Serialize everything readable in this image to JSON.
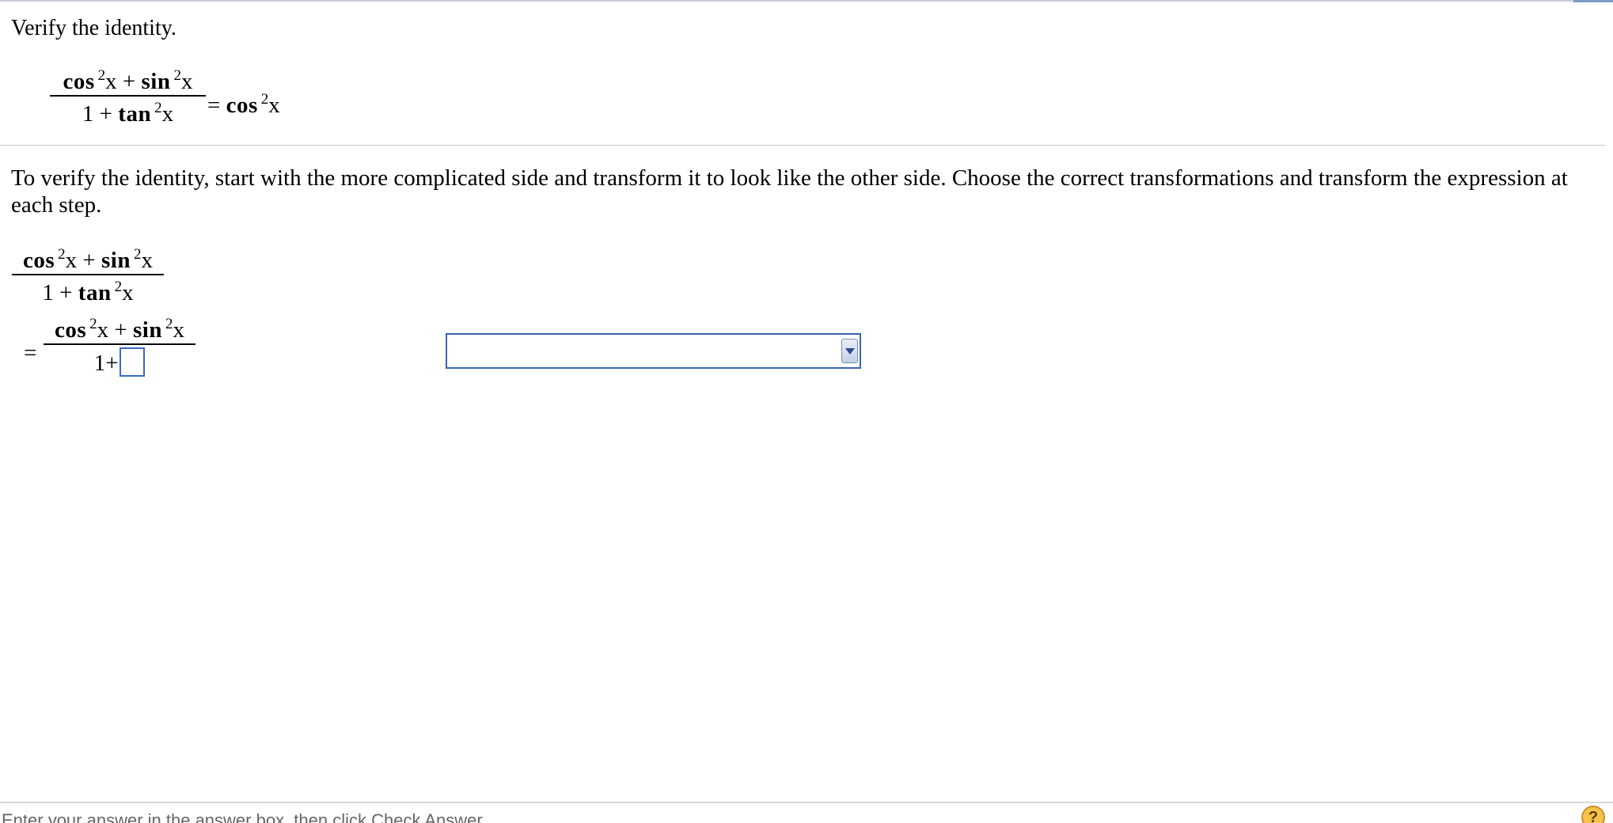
{
  "instruction": "Verify the identity.",
  "identity": {
    "lhs_numerator": {
      "cos": "cos",
      "exp1": "2",
      "x1": "x",
      "plus": "+",
      "sin": "sin",
      "exp2": "2",
      "x2": "x"
    },
    "lhs_denominator": {
      "one": "1",
      "plus": "+",
      "tan": "tan",
      "exp": "2",
      "x": "x"
    },
    "equals": "=",
    "rhs": {
      "cos": "cos",
      "exp": "2",
      "x": "x"
    }
  },
  "directions": "To verify the identity, start with the more complicated side and transform it to look like the other side. Choose the correct transformations and transform the expression at each step.",
  "work": {
    "step0_numerator": {
      "cos": "cos",
      "exp1": "2",
      "x1": "x",
      "plus": "+",
      "sin": "sin",
      "exp2": "2",
      "x2": "x"
    },
    "step0_denominator": {
      "one": "1",
      "plus": "+",
      "tan": "tan",
      "exp": "2",
      "x": "x"
    },
    "equals": "=",
    "step1_numerator": {
      "cos": "cos",
      "exp1": "2",
      "x1": "x",
      "plus": "+",
      "sin": "sin",
      "exp2": "2",
      "x2": "x"
    },
    "step1_denominator": {
      "one": "1",
      "plus": "+"
    },
    "answer_box_value": "",
    "transformation_dropdown_value": ""
  },
  "footer": {
    "hint": "Enter your answer in the answer box, then click Check Answer.",
    "help_icon": "?"
  },
  "colors": {
    "input_border": "#3a6bc6",
    "dropdown_border": "#3a64b4",
    "help_icon_fill": "#f5c34a"
  }
}
